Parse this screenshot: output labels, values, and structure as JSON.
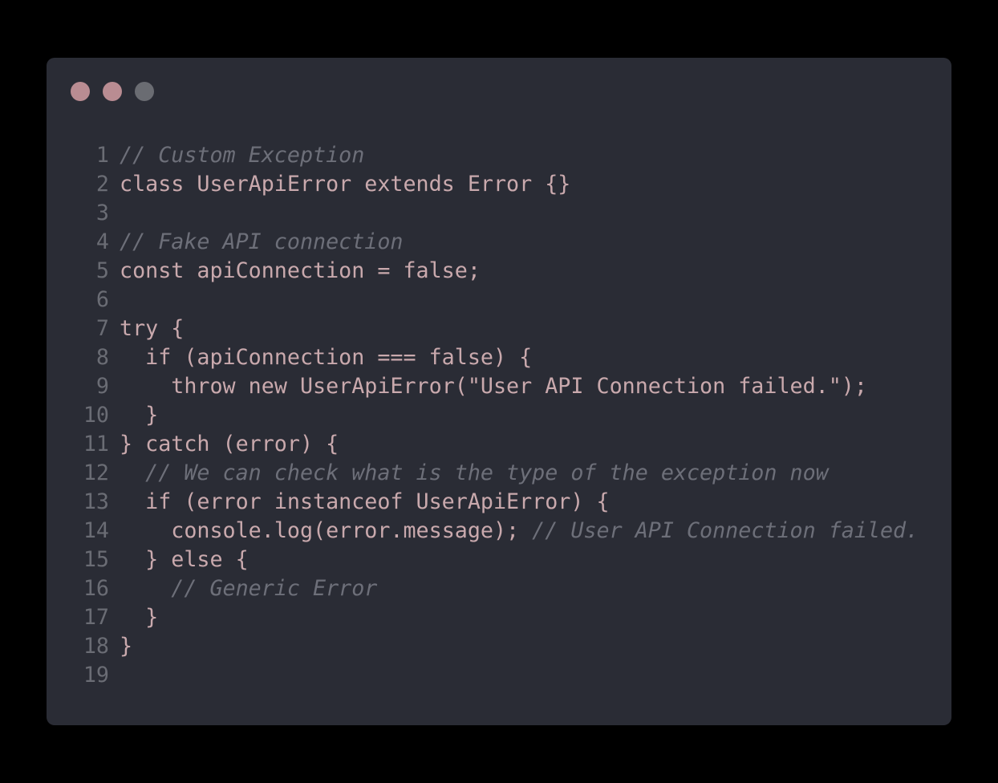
{
  "window": {
    "dots": [
      "#b98c92",
      "#b98c92",
      "#6a6c72"
    ]
  },
  "code": {
    "lines": [
      {
        "n": "1",
        "indent": "",
        "text": "",
        "comment": "// Custom Exception"
      },
      {
        "n": "2",
        "indent": "",
        "text": "class UserApiError extends Error {}",
        "comment": ""
      },
      {
        "n": "3",
        "indent": "",
        "text": "",
        "comment": ""
      },
      {
        "n": "4",
        "indent": "",
        "text": "",
        "comment": "// Fake API connection"
      },
      {
        "n": "5",
        "indent": "",
        "text": "const apiConnection = false;",
        "comment": ""
      },
      {
        "n": "6",
        "indent": "",
        "text": "",
        "comment": ""
      },
      {
        "n": "7",
        "indent": "",
        "text": "try {",
        "comment": ""
      },
      {
        "n": "8",
        "indent": "  ",
        "text": "if (apiConnection === false) {",
        "comment": ""
      },
      {
        "n": "9",
        "indent": "    ",
        "text": "throw new UserApiError(\"User API Connection failed.\");",
        "comment": ""
      },
      {
        "n": "10",
        "indent": "  ",
        "text": "}",
        "comment": ""
      },
      {
        "n": "11",
        "indent": "",
        "text": "} catch (error) {",
        "comment": ""
      },
      {
        "n": "12",
        "indent": "  ",
        "text": "",
        "comment": "// We can check what is the type of the exception now"
      },
      {
        "n": "13",
        "indent": "  ",
        "text": "if (error instanceof UserApiError) {",
        "comment": ""
      },
      {
        "n": "14",
        "indent": "    ",
        "text": "console.log(error.message); ",
        "comment": "// User API Connection failed."
      },
      {
        "n": "15",
        "indent": "  ",
        "text": "} else {",
        "comment": ""
      },
      {
        "n": "16",
        "indent": "    ",
        "text": "",
        "comment": "// Generic Error"
      },
      {
        "n": "17",
        "indent": "  ",
        "text": "}",
        "comment": ""
      },
      {
        "n": "18",
        "indent": "",
        "text": "}",
        "comment": ""
      },
      {
        "n": "19",
        "indent": "",
        "text": "",
        "comment": ""
      }
    ]
  }
}
